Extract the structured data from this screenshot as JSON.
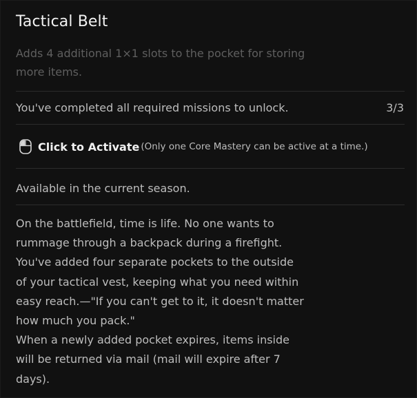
{
  "item": {
    "title": "Tactical Belt",
    "description": "Adds 4 additional 1×1 slots to the pocket for storing more items."
  },
  "unlock": {
    "requirement_text": "You've completed all required missions to unlock.",
    "progress": "3/3",
    "progress_fraction": 1.0
  },
  "activation": {
    "icon": "mouse-left-click-icon",
    "label": "Click to Activate",
    "note": "(Only one Core Mastery can be active at a time.)"
  },
  "availability": "Available in the current season.",
  "lore": {
    "lines": [
      "On the battlefield, time is life. No one wants to",
      "rummage through a backpack during a firefight.",
      "You've added four separate pockets to the outside",
      "of your tactical vest, keeping what you need within",
      "easy reach.—\"If you can't get to it, it doesn't matter",
      "how much you pack.\"",
      "When a newly added pocket expires, items inside",
      "will be returned via mail (mail will expire after 7",
      "days)."
    ]
  },
  "colors": {
    "panel_background": "#111111",
    "title_text": "#f2f2f2",
    "description_text": "#5f5f5f",
    "body_text": "#bdbdbd",
    "divider": "#2c2c2c"
  }
}
